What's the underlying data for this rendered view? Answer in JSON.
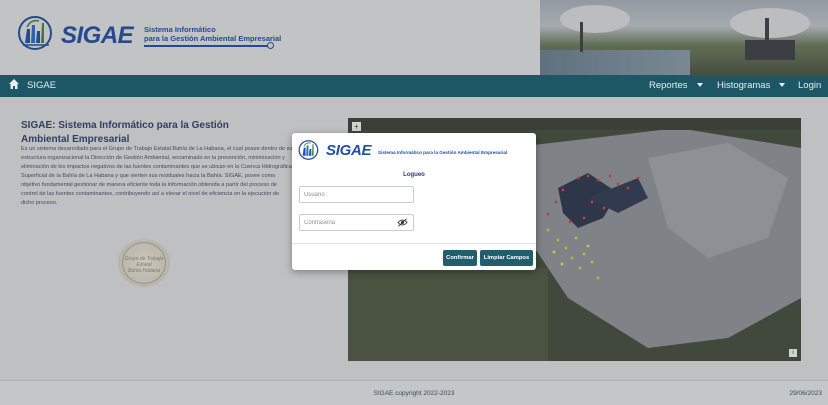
{
  "header": {
    "logo_word": "SIGAE",
    "logo_subtitle_line1": "Sistema Informático",
    "logo_subtitle_line2": "para la Gestión Ambiental Empresarial"
  },
  "navbar": {
    "brand": "SIGAE",
    "items": [
      {
        "label": "Reportes"
      },
      {
        "label": "Histogramas"
      },
      {
        "label": "Login"
      }
    ]
  },
  "intro": {
    "title": "SIGAE: Sistema Informático para la Gestión Ambiental Empresarial",
    "text": "Es un sistema desarrollado para el Grupo de Trabajo Estatal Bahía de La Habana, el cual posee dentro de su estructura organizacional la Dirección de Gestión Ambiental, encaminado en la prevención, minimización y eliminación de los impactos negativos de las fuentes contaminantes que se ubican en la Cuenca Hidrográfica Superficial de la Bahía de La Habana y que vierten sus residuales hacia la Bahía. SIGAE, posee como objetivo fundamental gestionar de manera eficiente toda la información obtenida a partir del proceso de control de las fuentes contaminantes, contribuyendo así a elevar el nivel de eficiencia en la ejecución de dicho proceso."
  },
  "seal": {
    "text_line1": "Grupo de Trabajo Estatal",
    "text_line2": "Bahía Habana"
  },
  "map": {
    "zoom_label": "+",
    "info_label": "i",
    "point_colors": [
      "#d83a2c",
      "#e0c62a",
      "#e8e84a"
    ]
  },
  "footer": {
    "copyright": "SIGAE copyright 2022-2023",
    "date": "29/06/2023"
  },
  "modal": {
    "logo_word": "SIGAE",
    "logo_subtitle": "Sistema Informático para la Gestión Ambiental Empresarial",
    "title": "Logueo",
    "user_placeholder": "Usuario",
    "user_value": "",
    "pass_placeholder": "Contraseña",
    "pass_value": "",
    "confirm_label": "Confirmar",
    "clear_label": "Limpiar Campos"
  },
  "colors": {
    "navbar": "#1d5766",
    "brand_blue": "#1f4fa8",
    "button": "#235c6d"
  }
}
